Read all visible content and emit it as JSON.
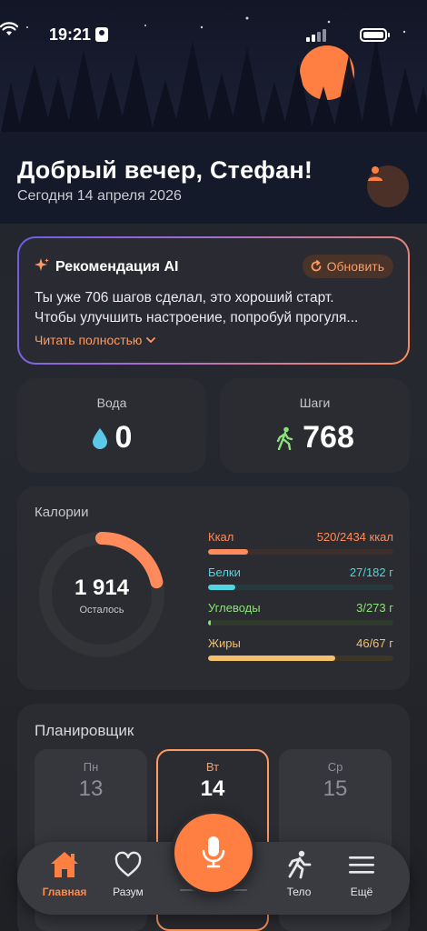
{
  "status_bar": {
    "time": "19:21"
  },
  "header": {
    "greeting": "Добрый вечер, Стефан!",
    "date": "Сегодня 14 апреля 2026"
  },
  "ai_card": {
    "title": "Рекомендация AI",
    "refresh_label": "Обновить",
    "text_line1": "Ты уже 706 шагов сделал, это хороший старт.",
    "text_line2": "Чтобы улучшить настроение, попробуй прогуля...",
    "read_more": "Читать полностью"
  },
  "water": {
    "label": "Вода",
    "value": "0"
  },
  "steps": {
    "label": "Шаги",
    "value": "768"
  },
  "calories": {
    "title": "Калории",
    "remaining": "1 914",
    "remaining_label": "Осталось",
    "ring_progress": 0.214,
    "macros": [
      {
        "name": "Ккал",
        "value": "520/2434 ккал",
        "progress": 0.214,
        "color": "#ff8a5b",
        "track": "#3d2f2c"
      },
      {
        "name": "Белки",
        "value": "27/182 г",
        "progress": 0.148,
        "color": "#4fd6e0",
        "track": "#263a3d"
      },
      {
        "name": "Углеводы",
        "value": "3/273 г",
        "progress": 0.011,
        "color": "#8ce27a",
        "track": "#2f3a2b"
      },
      {
        "name": "Жиры",
        "value": "46/67 г",
        "progress": 0.687,
        "color": "#f3c06b",
        "track": "#3d3526"
      }
    ]
  },
  "planner": {
    "title": "Планировщик",
    "days": [
      {
        "name": "Пн",
        "date": "13"
      },
      {
        "name": "Вт",
        "date": "14"
      },
      {
        "name": "Ср",
        "date": "15"
      }
    ]
  },
  "tabbar": {
    "items": [
      {
        "label": "Главная"
      },
      {
        "label": "Разум"
      },
      {
        "label": "Тело"
      },
      {
        "label": "Ещё"
      }
    ]
  },
  "colors": {
    "accent": "#ff7f43",
    "card": "#2b2c31",
    "background": "#24262c"
  }
}
